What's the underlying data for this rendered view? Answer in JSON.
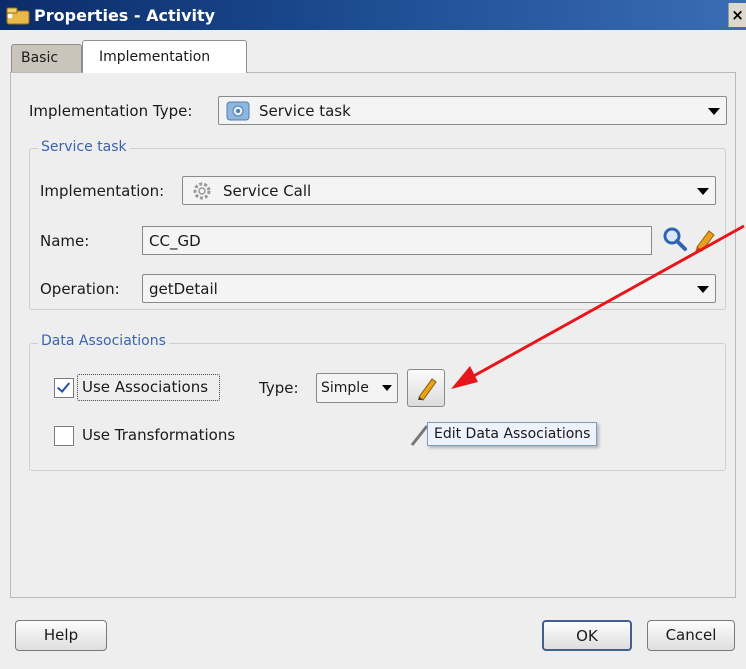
{
  "window": {
    "title": "Properties - Activity",
    "close_glyph": "×"
  },
  "tabs": [
    {
      "label": "Basic",
      "active": false
    },
    {
      "label": "Implementation",
      "active": true
    }
  ],
  "implementation_type": {
    "label": "Implementation Type:",
    "value": "Service task",
    "icon": "service-task-icon"
  },
  "service_task": {
    "group_title": "Service task",
    "implementation_label": "Implementation:",
    "implementation_value": "Service Call",
    "implementation_icon": "gear-icon",
    "name_label": "Name:",
    "name_value": "CC_GD",
    "operation_label": "Operation:",
    "operation_value": "getDetail"
  },
  "data_associations": {
    "group_title": "Data Associations",
    "use_associations_label": "Use Associations",
    "use_associations_checked": true,
    "type_label": "Type:",
    "type_value": "Simple",
    "use_transformations_label": "Use Transformations",
    "use_transformations_checked": false,
    "tooltip": "Edit Data Associations"
  },
  "footer": {
    "help_label": "Help",
    "ok_label": "OK",
    "cancel_label": "Cancel"
  },
  "annotation": {
    "arrow_color": "#e8161b"
  },
  "colors": {
    "titlebar_start": "#0b2c69",
    "titlebar_end": "#3a6db4",
    "group_title": "#3a63b0",
    "checkbox_check": "#2550a8"
  }
}
